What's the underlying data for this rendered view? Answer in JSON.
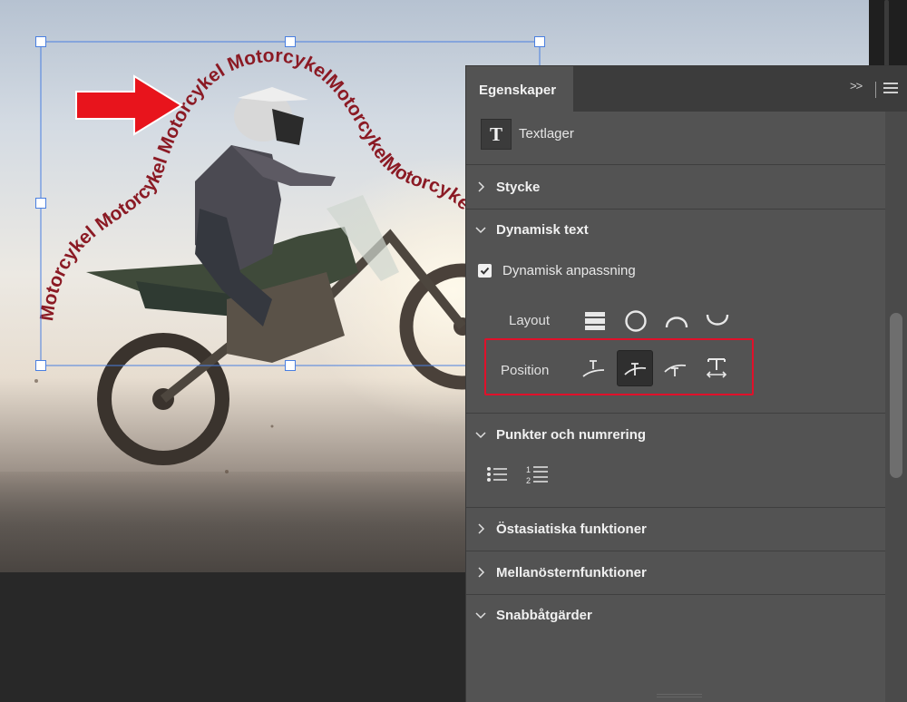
{
  "canvas": {
    "curved_text": "Motorcykel Motorcykel Motorcykel MotorcykelMotorcykelMotorcykel",
    "arrow_color": "#e8141c",
    "text_color": "#8b1a24",
    "bbox_color": "#4a7fe0"
  },
  "panel": {
    "tab_label": "Egenskaper",
    "collapse_icon": "double-chevron-right-icon",
    "menu_icon": "hamburger-menu-icon",
    "layer_type_icon": "text-layer-icon",
    "layer_type_label": "Textlager",
    "sections": {
      "paragraph": {
        "title": "Stycke",
        "expanded": false
      },
      "dynamic_text": {
        "title": "Dynamisk text",
        "expanded": true,
        "checkbox_label": "Dynamisk anpassning",
        "checkbox_checked": true,
        "layout_label": "Layout",
        "layout_options": [
          "layout-rows-icon",
          "layout-circle-icon",
          "layout-arch-icon",
          "layout-cup-icon"
        ],
        "position_label": "Position",
        "position_options": [
          "text-on-path-above-icon",
          "text-on-path-centered-icon",
          "text-on-path-below-icon",
          "text-fit-width-icon"
        ],
        "position_selected_index": 1,
        "highlight_color": "#e0102a"
      },
      "bullets": {
        "title": "Punkter och numrering",
        "expanded": true,
        "options": [
          "bulleted-list-icon",
          "numbered-list-icon"
        ]
      },
      "east_asian": {
        "title": "Östasiatiska funktioner",
        "expanded": false
      },
      "middle_east": {
        "title": "Mellanösternfunktioner",
        "expanded": false
      },
      "quick_actions": {
        "title": "Snabbåtgärder",
        "expanded": true
      }
    }
  }
}
